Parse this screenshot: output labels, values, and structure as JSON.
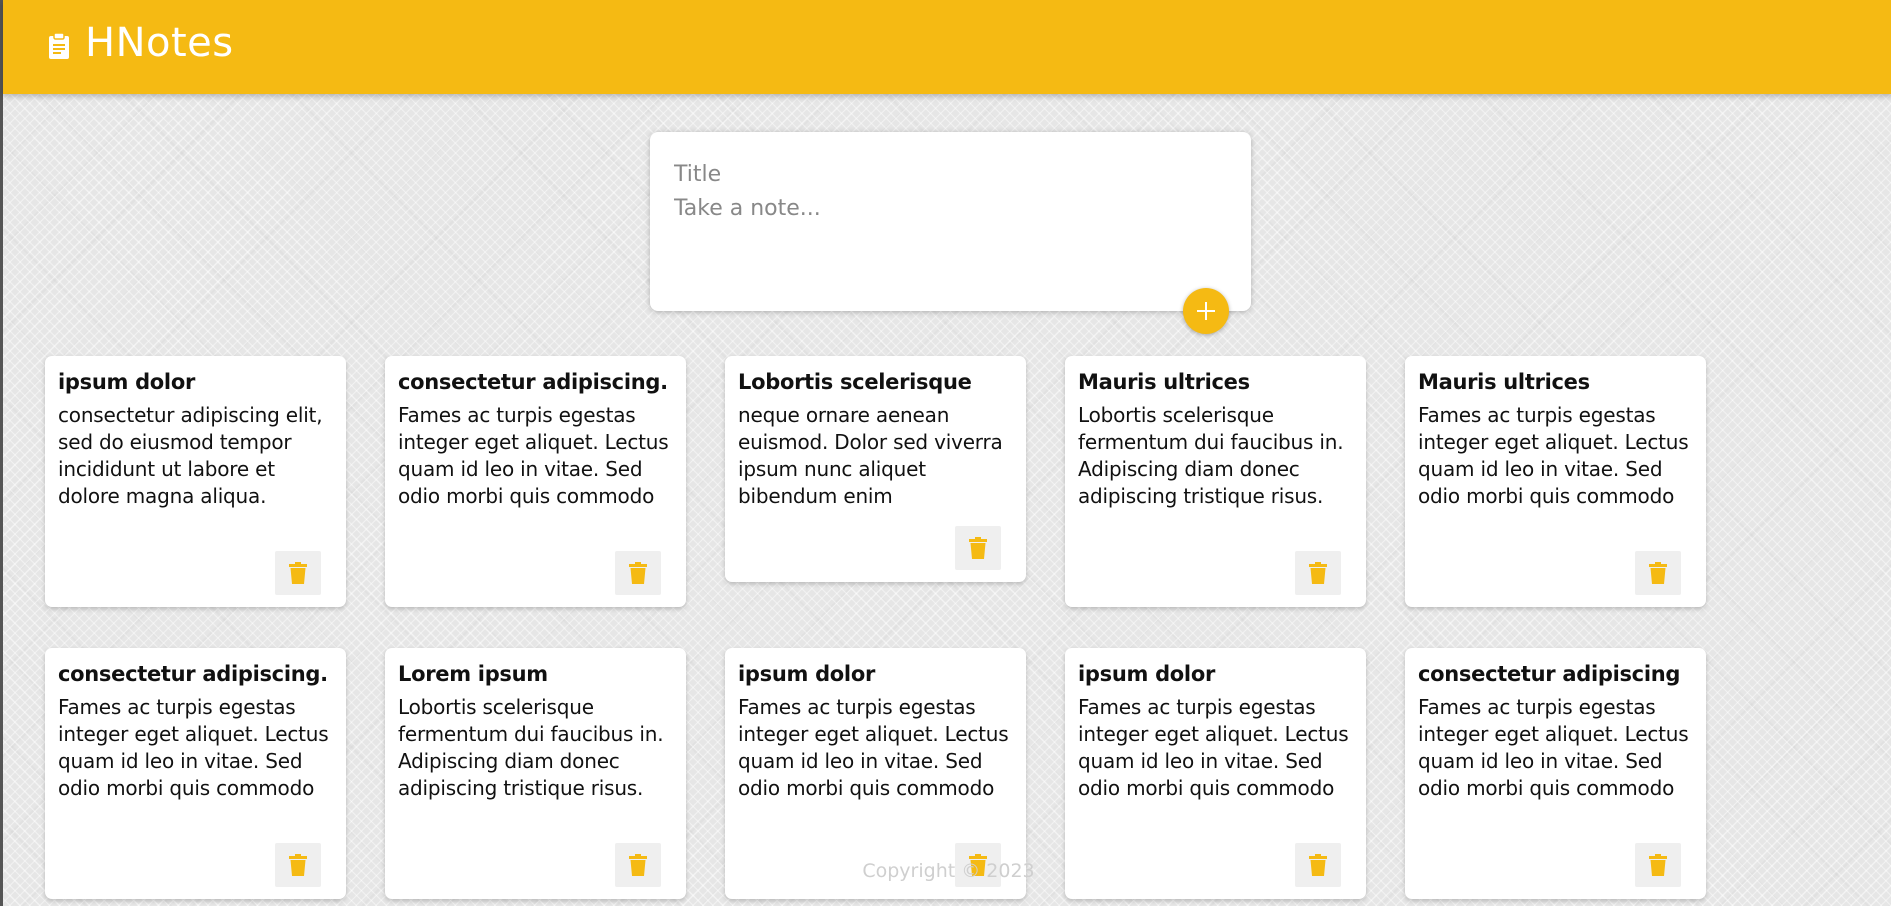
{
  "app": {
    "title": "HNotes",
    "icon": "clipboard-icon",
    "accent": "#f5ba13"
  },
  "create_area": {
    "title_placeholder": "Title",
    "content_placeholder": "Take a note...",
    "add_icon": "plus-icon"
  },
  "notes": [
    {
      "title": "ipsum dolor",
      "content": "consectetur adipiscing elit, sed do eiusmod tempor incididunt ut labore et dolore magna aliqua."
    },
    {
      "title": "consectetur adipiscing.",
      "content": "Fames ac turpis egestas integer eget aliquet. Lectus quam id leo in vitae. Sed odio morbi quis commodo"
    },
    {
      "title": "Lobortis scelerisque",
      "content": "neque ornare aenean euismod. Dolor sed viverra ipsum nunc aliquet bibendum enim"
    },
    {
      "title": "Mauris ultrices",
      "content": "Lobortis scelerisque fermentum dui faucibus in. Adipiscing diam donec adipiscing tristique risus."
    },
    {
      "title": "Mauris ultrices",
      "content": "Fames ac turpis egestas integer eget aliquet. Lectus quam id leo in vitae. Sed odio morbi quis commodo"
    },
    {
      "title": "consectetur adipiscing.",
      "content": "Fames ac turpis egestas integer eget aliquet. Lectus quam id leo in vitae. Sed odio morbi quis commodo"
    },
    {
      "title": "Lorem ipsum",
      "content": "Lobortis scelerisque fermentum dui faucibus in. Adipiscing diam donec adipiscing tristique risus."
    },
    {
      "title": "ipsum dolor",
      "content": "Fames ac turpis egestas integer eget aliquet. Lectus quam id leo in vitae. Sed odio morbi quis commodo"
    },
    {
      "title": "ipsum dolor",
      "content": "Fames ac turpis egestas integer eget aliquet. Lectus quam id leo in vitae. Sed odio morbi quis commodo"
    },
    {
      "title": "consectetur adipiscing",
      "content": "Fames ac turpis egestas integer eget aliquet. Lectus quam id leo in vitae. Sed odio morbi quis commodo"
    }
  ],
  "delete_icon": "trash-icon",
  "footer": {
    "copyright": "Copyright © 2023"
  }
}
